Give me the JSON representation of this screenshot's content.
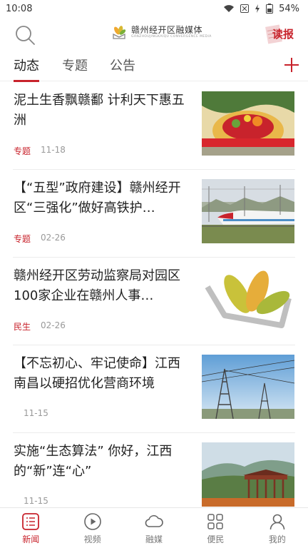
{
  "status_bar": {
    "time": "10:08",
    "battery": "54%"
  },
  "header": {
    "brand_title": "赣州经开区融媒体",
    "brand_subtitle": "GANZHOUJINGKAIQU CONVERGENCE MEDIA",
    "read_paper_label": "读报"
  },
  "tabs": [
    {
      "label": "动态",
      "active": true
    },
    {
      "label": "专题",
      "active": false
    },
    {
      "label": "公告",
      "active": false
    }
  ],
  "news": [
    {
      "title": "泥土生香飘赣鄱 计利天下惠五洲",
      "tag": "专题",
      "date": "11-18",
      "thumb_text": "第十七届中国国际农产品交易会"
    },
    {
      "title": "【“五型”政府建设】赣州经开区“三强化”做好高铁护…",
      "tag": "专题",
      "date": "02-26"
    },
    {
      "title": "赣州经开区劳动监察局对园区100家企业在赣州人事…",
      "tag": "民生",
      "date": "02-26"
    },
    {
      "title": "【不忘初心、牢记使命】江西南昌以硬招优化营商环境",
      "tag": "",
      "date": "11-15"
    },
    {
      "title": "实施“生态算法” 你好，江西的“新”连“心”",
      "tag": "",
      "date": "11-15"
    }
  ],
  "bottom_nav": [
    {
      "label": "新闻",
      "icon": "news-icon",
      "active": true
    },
    {
      "label": "视频",
      "icon": "play-icon",
      "active": false
    },
    {
      "label": "融媒",
      "icon": "cloud-icon",
      "active": false
    },
    {
      "label": "便民",
      "icon": "grid-icon",
      "active": false
    },
    {
      "label": "我的",
      "icon": "person-icon",
      "active": false
    }
  ],
  "colors": {
    "accent": "#c8232c"
  }
}
